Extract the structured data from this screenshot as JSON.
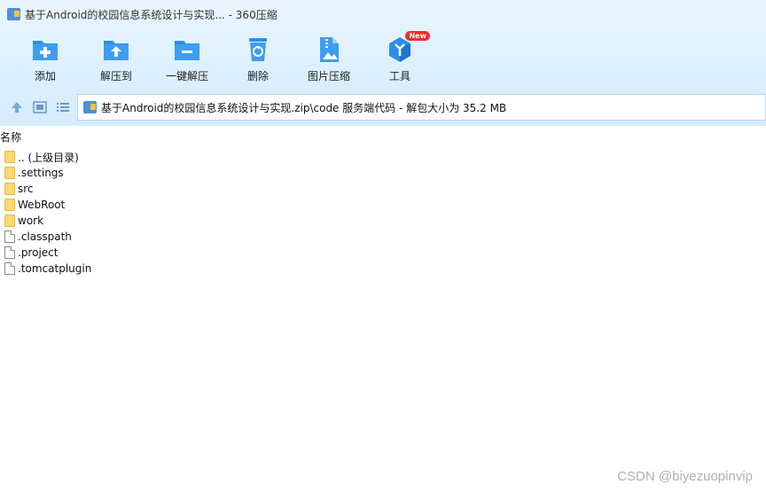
{
  "window": {
    "title": "基于Android的校园信息系统设计与实现... - 360压缩"
  },
  "toolbar": {
    "items": [
      {
        "label": "添加",
        "icon": "add-icon"
      },
      {
        "label": "解压到",
        "icon": "extract-to-icon"
      },
      {
        "label": "一键解压",
        "icon": "one-click-extract-icon"
      },
      {
        "label": "删除",
        "icon": "delete-icon"
      },
      {
        "label": "图片压缩",
        "icon": "image-compress-icon"
      },
      {
        "label": "工具",
        "icon": "tools-icon",
        "badge": "New"
      }
    ]
  },
  "addressbar": {
    "path": "基于Android的校园信息系统设计与实现.zip\\code 服务端代码 - 解包大小为 35.2 MB"
  },
  "filelist": {
    "column_name": "名称",
    "rows": [
      {
        "name": ".. (上级目录)",
        "type": "folder"
      },
      {
        "name": ".settings",
        "type": "folder"
      },
      {
        "name": "src",
        "type": "folder"
      },
      {
        "name": "WebRoot",
        "type": "folder"
      },
      {
        "name": "work",
        "type": "folder"
      },
      {
        "name": ".classpath",
        "type": "file"
      },
      {
        "name": ".project",
        "type": "file"
      },
      {
        "name": ".tomcatplugin",
        "type": "file"
      }
    ]
  },
  "watermark": "CSDN @biyezuopinvip",
  "colors": {
    "accent": "#2b8fe8",
    "folder": "#fbd96c",
    "badge": "#e9302b"
  }
}
